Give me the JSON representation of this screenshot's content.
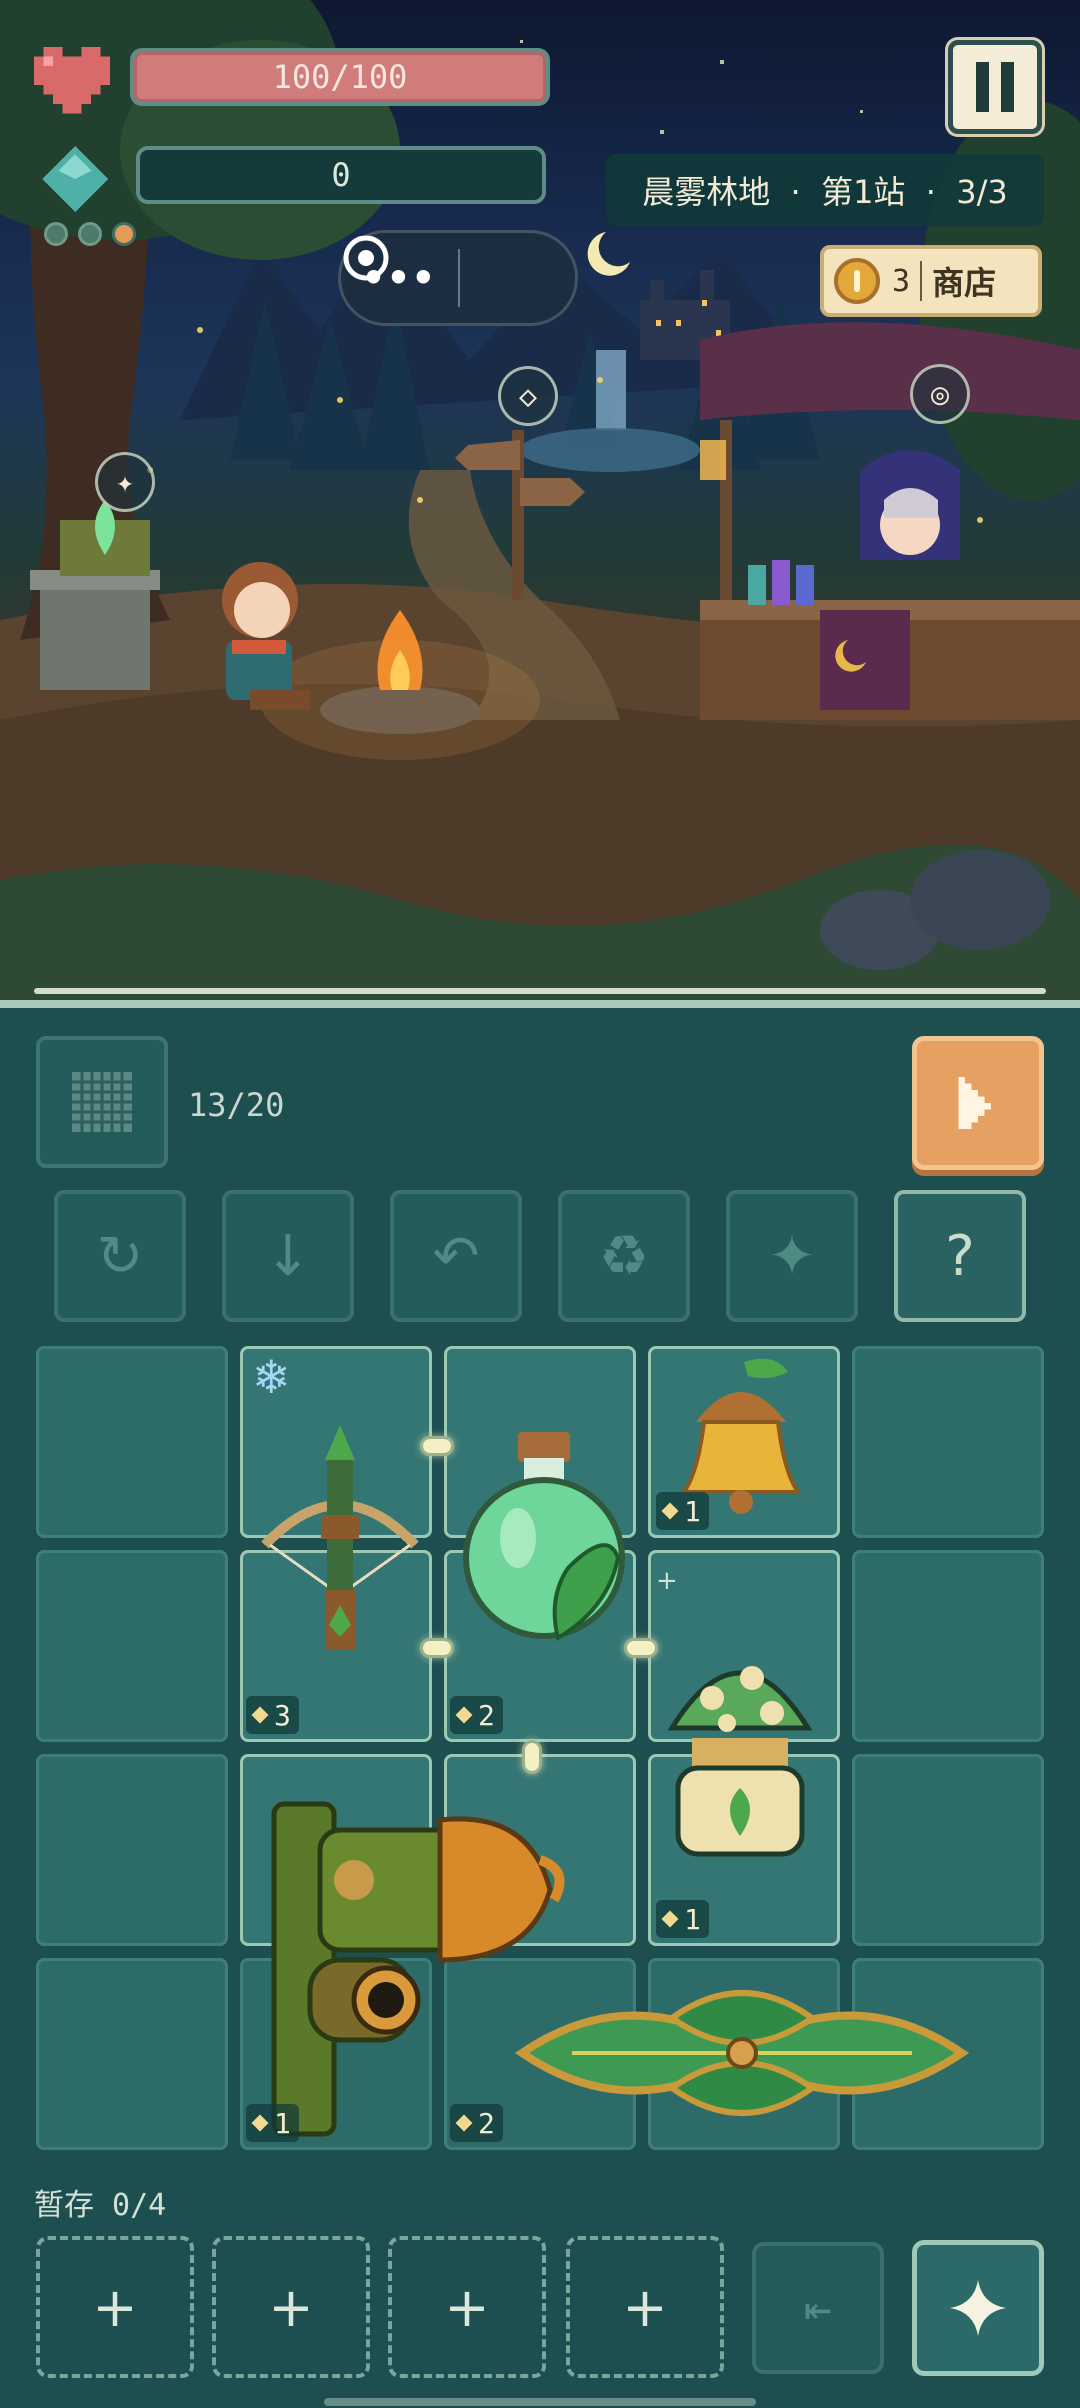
{
  "hud": {
    "hp_text": "100/100",
    "mana_text": "0",
    "stage_dots": [
      "inactive",
      "inactive",
      "active"
    ],
    "pause_icon": "pause-icon",
    "location": "晨雾林地  ·  第1站  ·  3/3",
    "gold_count": "3",
    "shop_label": "商店",
    "menu_icon": "more-dots-icon",
    "record_icon": "target-icon"
  },
  "scene": {
    "markers": [
      "star-marker-icon",
      "diamond-marker-icon",
      "target-marker-icon"
    ],
    "characters": [
      "elf-girl-at-campfire",
      "hooded-shopkeeper"
    ]
  },
  "board": {
    "piece_count": "13/20",
    "tools": [
      "rotate-icon",
      "down-arrow-icon",
      "undo-icon",
      "recycle-icon",
      "sparkle-icon",
      "?"
    ],
    "items": [
      {
        "name": "crossbow",
        "level": "3",
        "frozen": true
      },
      {
        "name": "leaf-potion",
        "level": "2"
      },
      {
        "name": "acorn-bell",
        "level": "1"
      },
      {
        "name": "mushroom-jar",
        "level": "1"
      },
      {
        "name": "acorn-cannon",
        "level": "1"
      },
      {
        "name": "leaf-blade",
        "level": "2"
      }
    ]
  },
  "stash": {
    "label": "暂存 0/4",
    "slot_symbol": "+"
  },
  "colors": {
    "hp": "#d07c7a",
    "accent": "#e6a062",
    "panel": "#1e4f50",
    "cell": "#2d6b68"
  }
}
